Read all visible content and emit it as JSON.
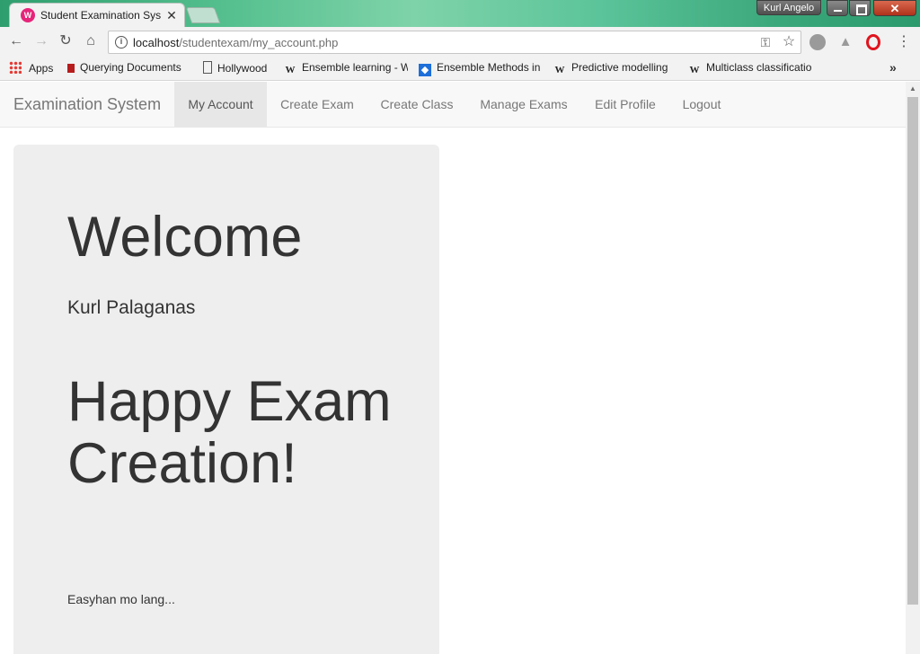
{
  "browser": {
    "tab": {
      "title": "Student Examination System",
      "favicon": "wamp-icon",
      "close": "✕"
    },
    "profile_name": "Kurl Angelo",
    "window_close": "✕",
    "url": {
      "host": "localhost",
      "path": "/studentexam/my_account.php"
    },
    "bookmarks": [
      {
        "label": "Apps",
        "icon": "apps-grid-icon"
      },
      {
        "label": "Querying Documents",
        "icon": "bookmark-red-icon"
      },
      {
        "label": "Hollywood",
        "icon": "page-icon"
      },
      {
        "label": "Ensemble learning - W",
        "icon": "wikipedia-icon"
      },
      {
        "label": "Ensemble Methods in",
        "icon": "blue-diamond-icon"
      },
      {
        "label": "Predictive modelling",
        "icon": "wikipedia-icon"
      },
      {
        "label": "Multiclass classificatio",
        "icon": "wikipedia-icon"
      }
    ],
    "more_bookmarks": "»"
  },
  "app": {
    "brand": "Examination System",
    "nav": [
      {
        "label": "My Account",
        "active": true
      },
      {
        "label": "Create Exam",
        "active": false
      },
      {
        "label": "Create Class",
        "active": false
      },
      {
        "label": "Manage Exams",
        "active": false
      },
      {
        "label": "Edit Profile",
        "active": false
      },
      {
        "label": "Logout",
        "active": false
      }
    ]
  },
  "content": {
    "welcome": "Welcome",
    "username": "Kurl Palaganas",
    "headline": "Happy Exam Creation!",
    "tagline": "Easyhan mo lang..."
  },
  "colors": {
    "titlebar_accent": "#56c08f",
    "navbar_bg": "#f8f8f8",
    "active_nav_bg": "#e7e7e7",
    "jumbotron_bg": "#eeeeee",
    "text": "#333333",
    "nav_text": "#777777"
  }
}
